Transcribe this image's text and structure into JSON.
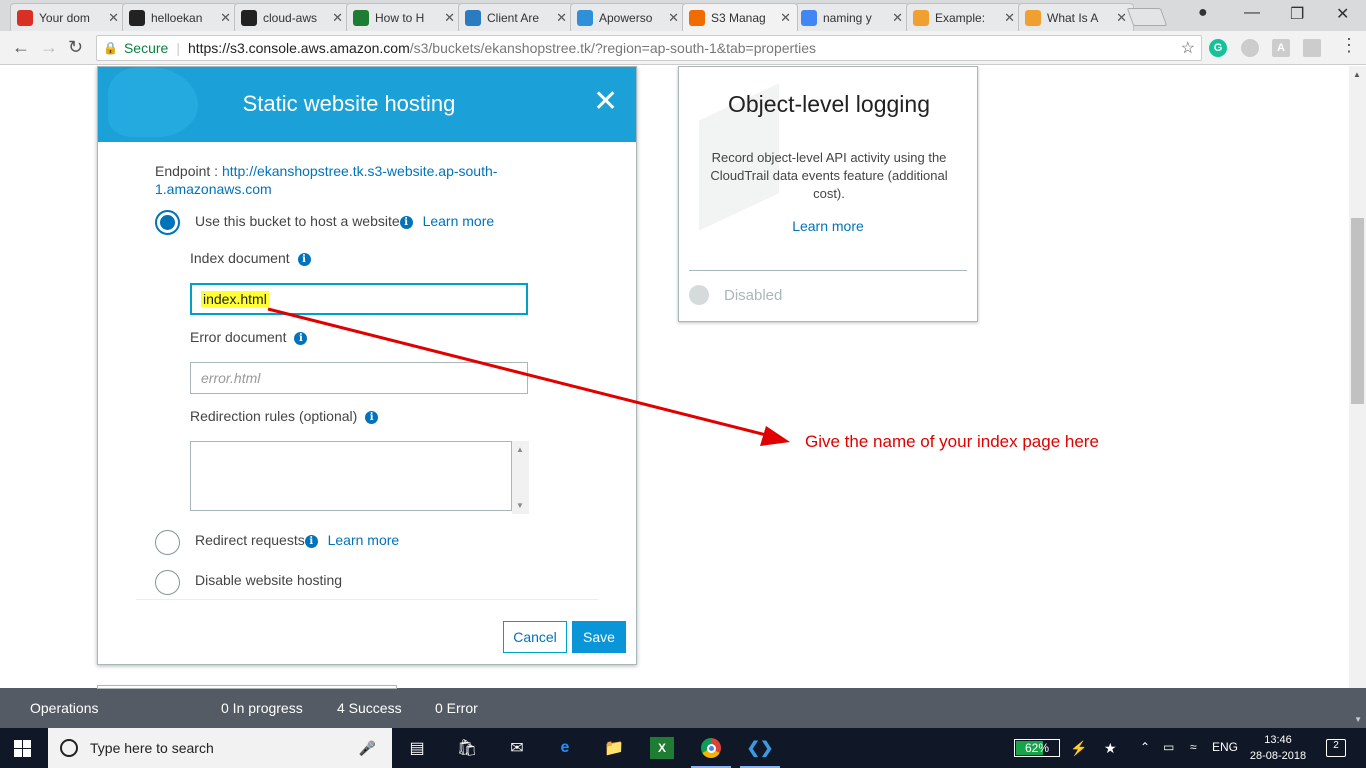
{
  "browser": {
    "tabs": [
      {
        "label": "Your dom",
        "icon": "gmail-icon",
        "color": "#d93025"
      },
      {
        "label": "helloekan",
        "icon": "github-icon",
        "color": "#222222"
      },
      {
        "label": "cloud-aws",
        "icon": "github-icon",
        "color": "#222222"
      },
      {
        "label": "How to H",
        "icon": "upwork-icon",
        "color": "#1e7d32"
      },
      {
        "label": "Client Are",
        "icon": "fn-icon",
        "color": "#2a7bbf"
      },
      {
        "label": "Apowerso",
        "icon": "apowersoft-icon",
        "color": "#2f8fd8"
      },
      {
        "label": "S3 Manag",
        "icon": "aws-s3-icon",
        "color": "#ef6c00"
      },
      {
        "label": "naming y",
        "icon": "google-icon",
        "color": "#4285f4"
      },
      {
        "label": "Example:",
        "icon": "aws-docs-icon",
        "color": "#f0a030"
      },
      {
        "label": "What Is A",
        "icon": "aws-docs-icon",
        "color": "#f0a030"
      }
    ],
    "active_tab": 6,
    "secure_label": "Secure",
    "url_host": "https://s3.console.aws.amazon.com",
    "url_path": "/s3/buckets/ekanshopstree.tk/?region=ap-south-1&tab=properties",
    "extensions": [
      "G",
      "A"
    ]
  },
  "modal": {
    "title": "Static website hosting",
    "endpoint_label": "Endpoint :",
    "endpoint_url": "http://ekanshopstree.tk.s3-website.ap-south-",
    "endpoint_url_2": "1.amazonaws.com",
    "option_host": "Use this bucket to host a website",
    "learn_more": "Learn more",
    "index_label": "Index document",
    "index_value": "index.html",
    "error_label": "Error document",
    "error_placeholder": "error.html",
    "redirection_label": "Redirection rules (optional)",
    "option_redirect": "Redirect requests",
    "option_disable": "Disable website hosting",
    "cancel": "Cancel",
    "save": "Save"
  },
  "logging_card": {
    "title": "Object-level logging",
    "description": "Record object-level API activity using the CloudTrail data events feature (additional cost).",
    "learn_more": "Learn more",
    "status": "Disabled"
  },
  "annotation": {
    "text": "Give the name of your index page here",
    "color": "#e10000"
  },
  "operations": {
    "label": "Operations",
    "in_progress": "0 In progress",
    "success": "4 Success",
    "error": "0 Error"
  },
  "taskbar": {
    "search_placeholder": "Type here to search",
    "battery": "62%",
    "battery_level": 0.62,
    "language": "ENG",
    "time": "13:46",
    "date": "28-08-2018",
    "notifications": "2"
  }
}
